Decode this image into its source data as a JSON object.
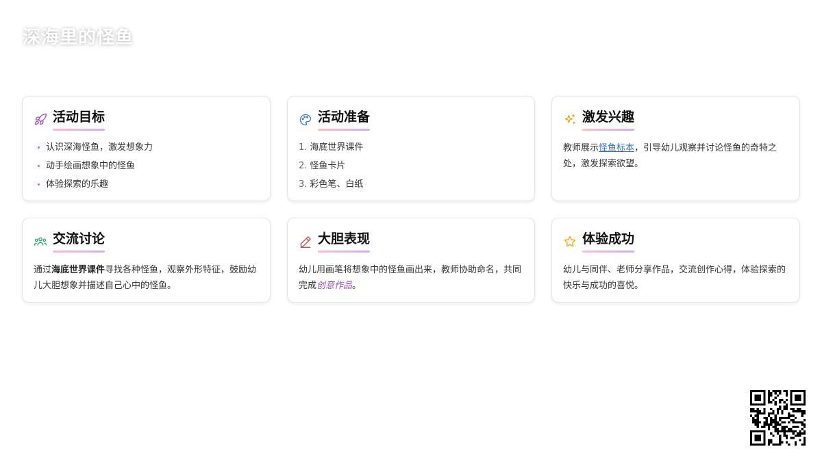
{
  "title": "深海里的怪鱼",
  "cards": [
    {
      "title": "活动目标",
      "icon": "rocket-icon",
      "items": [
        "认识深海怪鱼，激发想象力",
        "动手绘画想象中的怪鱼",
        "体验探索的乐趣"
      ]
    },
    {
      "title": "活动准备",
      "icon": "palette-icon",
      "items": [
        {
          "num": "1.",
          "text": "海底世界课件"
        },
        {
          "num": "2.",
          "text": "怪鱼卡片"
        },
        {
          "num": "3.",
          "text": "彩色笔、白纸"
        }
      ]
    },
    {
      "title": "激发兴趣",
      "icon": "sparkles-icon",
      "text": {
        "before": "教师展示",
        "link": "怪鱼标本",
        "after": "，引导幼儿观察并讨论怪鱼的奇特之处，激发探索欲望。"
      }
    },
    {
      "title": "交流讨论",
      "icon": "users-icon",
      "text": {
        "before": "通过",
        "bold": "海底世界课件",
        "after": "寻找各种怪鱼，观察外形特征，鼓励幼儿大胆想象并描述自己心中的怪鱼。"
      }
    },
    {
      "title": "大胆表现",
      "icon": "pencil-icon",
      "text": {
        "before": "幼儿用画笔将想象中的怪鱼画出来，教师协助命名，共同完成",
        "italic": "创意作品",
        "after": "。"
      }
    },
    {
      "title": "体验成功",
      "icon": "star-icon",
      "text": {
        "before": "幼儿与同伴、老师分享作品，交流创作心得，体验探索的快乐与成功的喜悦。"
      }
    }
  ],
  "qr": {
    "icon": "qr-code-icon"
  },
  "colors": {
    "rocket": "#9b4fc9",
    "palette": "#3a7bc8",
    "sparkles": "#e6a817",
    "users": "#2aa86b",
    "pencil": "#d64545",
    "star": "#e6a817",
    "link": "#2f6fd1",
    "underline_start": "#f7c1c9",
    "underline_end": "#c9b4e6"
  }
}
